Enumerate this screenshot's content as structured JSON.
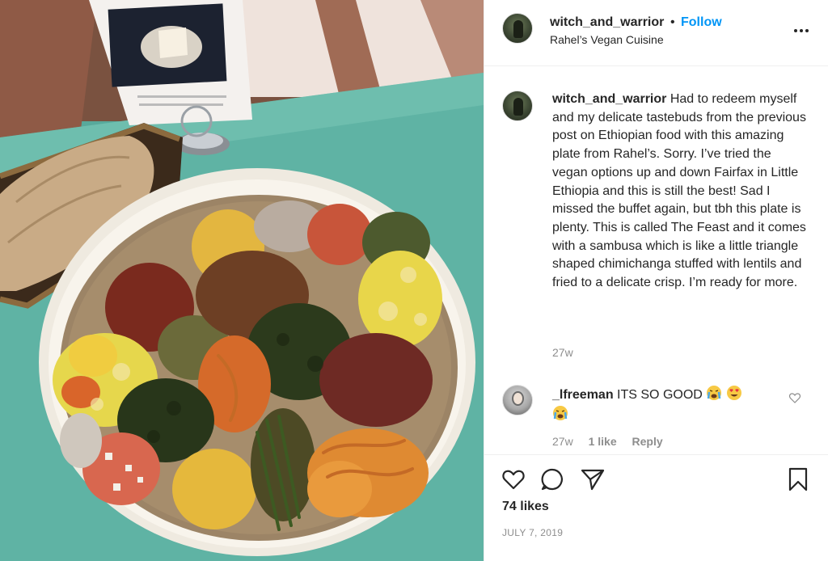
{
  "post": {
    "username": "witch_and_warrior",
    "separator": "•",
    "follow_label": "Follow",
    "location": "Rahel’s Vegan Cuisine",
    "more_icon": "more-options-icon",
    "photo_alt": "Ethiopian vegan feast platter on injera"
  },
  "caption": {
    "username": "witch_and_warrior",
    "text": "Had to redeem myself and my delicate tastebuds from the previous post on Ethiopian food with this amazing plate from Rahel’s. Sorry. I’ve tried the vegan options up and down Fairfax in Little Ethiopia and this is still the best! Sad I missed the buffet again, but tbh this plate is plenty. This is called The Feast and it comes with a sambusa which is like a little triangle shaped chimichanga stuffed with lentils and fried to a delicate crisp. I’m ready for more.",
    "time": "27w"
  },
  "comments": [
    {
      "username": "_lfreeman",
      "text": "ITS SO GOOD",
      "emojis": [
        "crying-face-emoji",
        "heart-eyes-emoji",
        "crying-face-emoji"
      ],
      "time": "27w",
      "likes": "1 like",
      "reply_label": "Reply"
    }
  ],
  "actions": {
    "likes": "74 likes",
    "date": "JULY 7, 2019",
    "icons": [
      "heart-icon",
      "comment-icon",
      "share-icon",
      "bookmark-icon"
    ]
  },
  "colors": {
    "link_blue": "#0095f6",
    "text": "#262626",
    "muted": "#8e8e8e",
    "border": "#efefef"
  }
}
